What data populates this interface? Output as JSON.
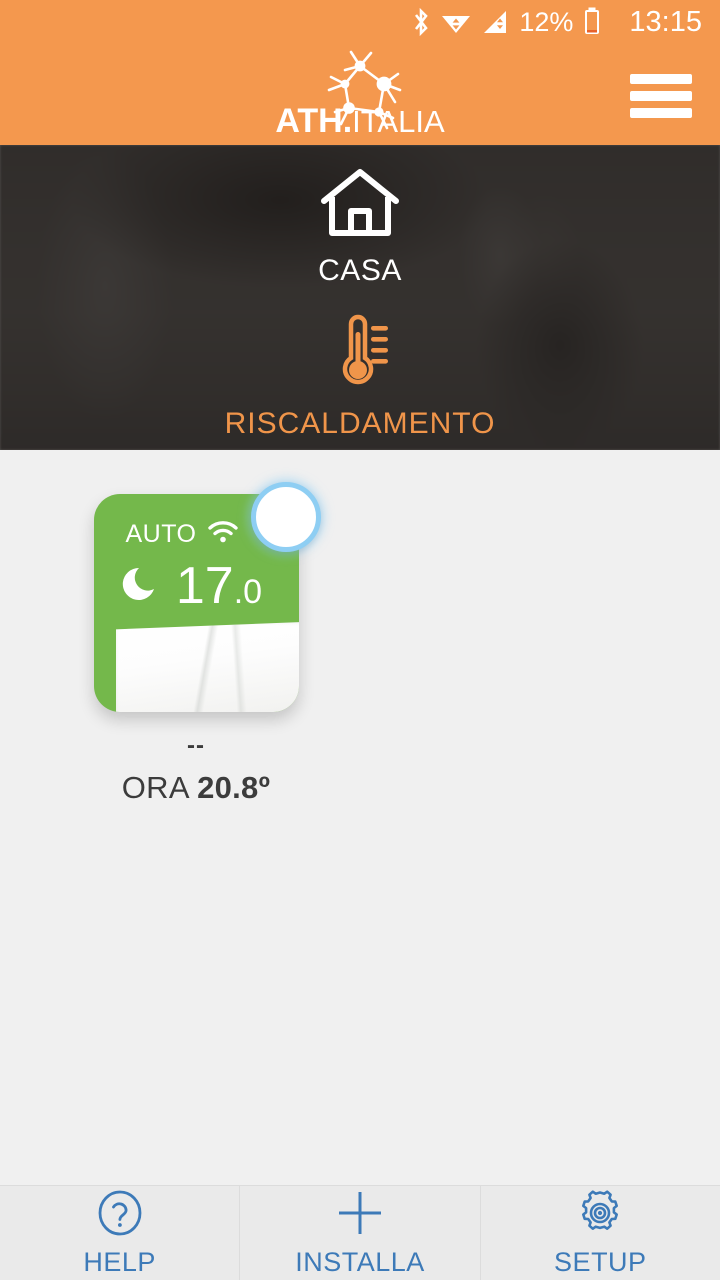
{
  "statusbar": {
    "icons": [
      "bluetooth-icon",
      "wifi-icon",
      "cellular-signal-icon",
      "battery-icon"
    ],
    "battery_percent": "12%",
    "clock": "13:15"
  },
  "header": {
    "logo_main": "ATH",
    "logo_dot": ".",
    "logo_sub": "ITALIA",
    "menu_icon": "hamburger-menu-icon",
    "background_color": "#f4984e"
  },
  "hero": {
    "house": {
      "icon": "house-icon",
      "label": "CASA"
    },
    "heating": {
      "icon": "thermometer-icon",
      "label": "RISCALDAMENTO",
      "color": "#f0954a"
    }
  },
  "main": {
    "device": {
      "mode": "AUTO",
      "wifi_icon": "wifi-icon",
      "schedule_icon": "moon-icon",
      "setpoint_int": "17",
      "setpoint_dec": ".0",
      "power_toggle": "power-toggle-on",
      "card_color": "#74b84b",
      "name": "--",
      "current_label": "ORA",
      "current_value": "20.8º"
    }
  },
  "bottomnav": {
    "accent_color": "#3d7ab8",
    "items": [
      {
        "icon": "question-circle-icon",
        "label": "HELP"
      },
      {
        "icon": "plus-icon",
        "label": "INSTALLA"
      },
      {
        "icon": "gear-icon",
        "label": "SETUP"
      }
    ]
  }
}
